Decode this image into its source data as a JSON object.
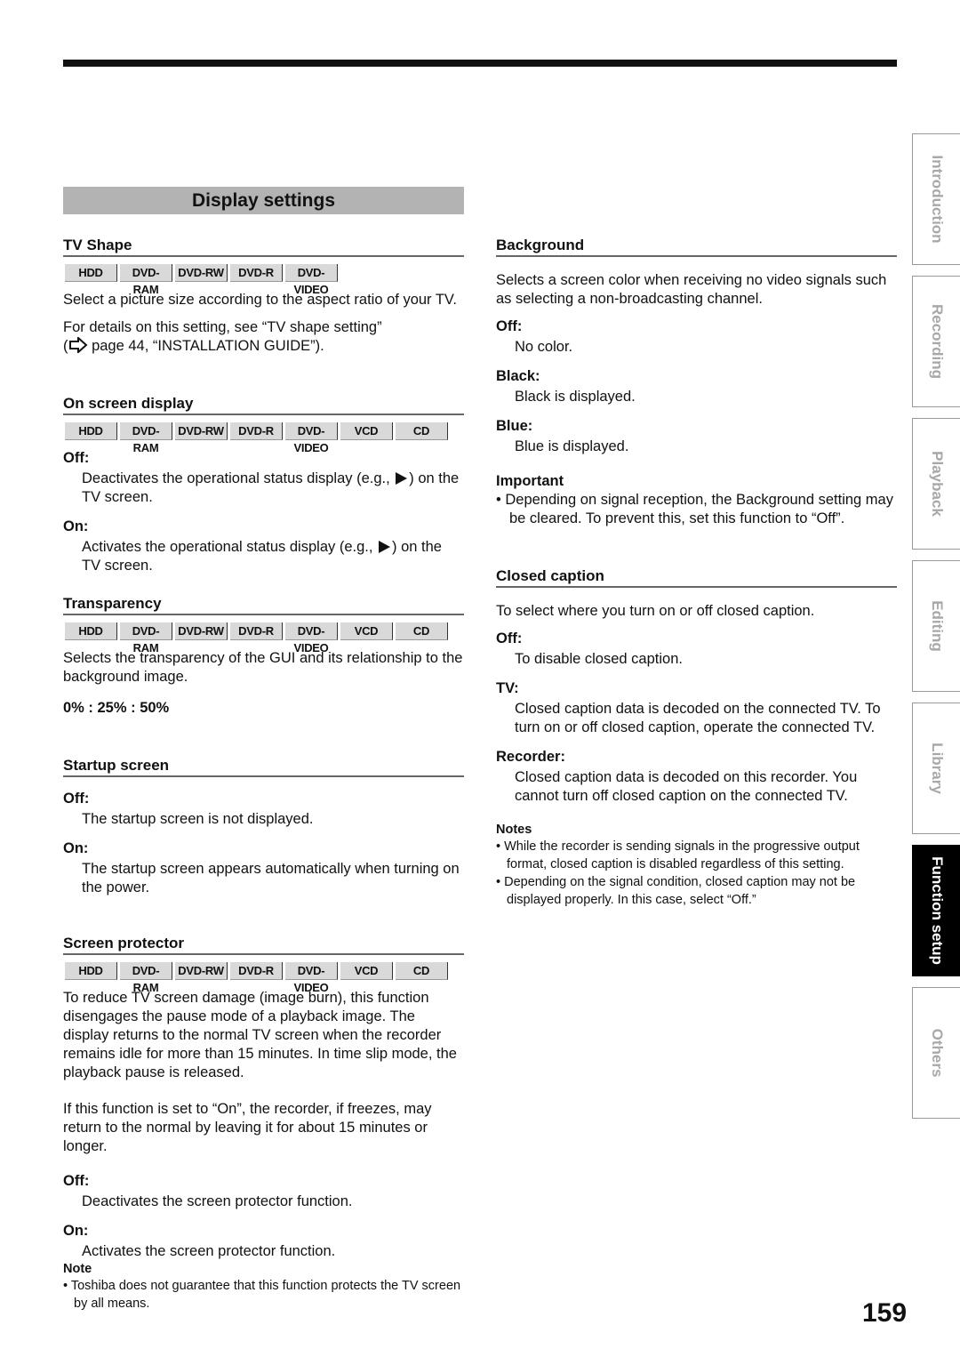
{
  "page": {
    "title": "Display settings",
    "page_number": "159"
  },
  "side_tabs": [
    {
      "label": "Introduction",
      "active": false
    },
    {
      "label": "Recording",
      "active": false
    },
    {
      "label": "Playback",
      "active": false
    },
    {
      "label": "Editing",
      "active": false
    },
    {
      "label": "Library",
      "active": false
    },
    {
      "label": "Function setup",
      "active": true
    },
    {
      "label": "Others",
      "active": false
    }
  ],
  "media": [
    "HDD",
    "DVD-RAM",
    "DVD-RW",
    "DVD-R",
    "DVD-VIDEO",
    "VCD",
    "CD"
  ],
  "left": {
    "tv_shape": {
      "heading": "TV Shape",
      "body1": "Select a picture size according to the aspect ratio of your TV.",
      "body2a": "For details on this setting, see “TV shape setting”",
      "body2b_open": "(",
      "body2b": " page 44, “INSTALLATION GUIDE”)."
    },
    "osd": {
      "heading": "On screen display",
      "off_label": "Off:",
      "off_text_a": "Deactivates the operational status display (e.g., ",
      "off_text_b": ") on the TV screen.",
      "on_label": "On:",
      "on_text_a": "Activates the operational status display (e.g., ",
      "on_text_b": ") on the TV screen."
    },
    "transparency": {
      "heading": "Transparency",
      "body": "Selects the transparency of the GUI and its relationship to the background image.",
      "options": "0% : 25% : 50%"
    },
    "startup": {
      "heading": "Startup screen",
      "off_label": "Off:",
      "off_text": "The startup screen is not displayed.",
      "on_label": "On:",
      "on_text": "The startup screen appears automatically when turning on the power."
    },
    "protector": {
      "heading": "Screen protector",
      "body1": "To reduce TV screen damage (image burn), this function disengages the pause mode of a playback image. The display returns to the normal TV screen when the recorder remains idle for more than 15 minutes. In time slip mode, the playback pause is released.",
      "body2": "If this function is set to “On”, the recorder, if freezes, may return to the normal by leaving it for about 15 minutes or longer.",
      "off_label": "Off:",
      "off_text": "Deactivates the screen protector function.",
      "on_label": "On:",
      "on_text": "Activates the screen protector function.",
      "note_heading": "Note",
      "note": "• Toshiba does not guarantee that this function protects the TV screen by all means."
    }
  },
  "right": {
    "background": {
      "heading": "Background",
      "body": "Selects a screen color when receiving no video signals such as selecting a non-broadcasting channel.",
      "off_label": "Off:",
      "off_text": "No color.",
      "black_label": "Black:",
      "black_text": "Black is displayed.",
      "blue_label": "Blue:",
      "blue_text": "Blue is displayed.",
      "important_heading": "Important",
      "important": "• Depending on signal reception, the Background setting may be cleared. To prevent this, set this function to “Off”."
    },
    "closed_caption": {
      "heading": "Closed caption",
      "body": "To select where you turn on or off closed caption.",
      "off_label": "Off:",
      "off_text": "To disable closed caption.",
      "tv_label": "TV:",
      "tv_text": "Closed caption data is decoded on the connected TV. To turn on or off closed caption, operate the connected TV.",
      "rec_label": "Recorder:",
      "rec_text": "Closed caption data is decoded on this recorder. You cannot turn off closed caption on the connected TV.",
      "notes_heading": "Notes",
      "notes": [
        "• While the recorder is sending signals in the progressive output format, closed caption is disabled regardless of this setting.",
        "• Depending on the signal condition, closed caption may not be displayed properly. In this case, select “Off.”"
      ]
    }
  }
}
